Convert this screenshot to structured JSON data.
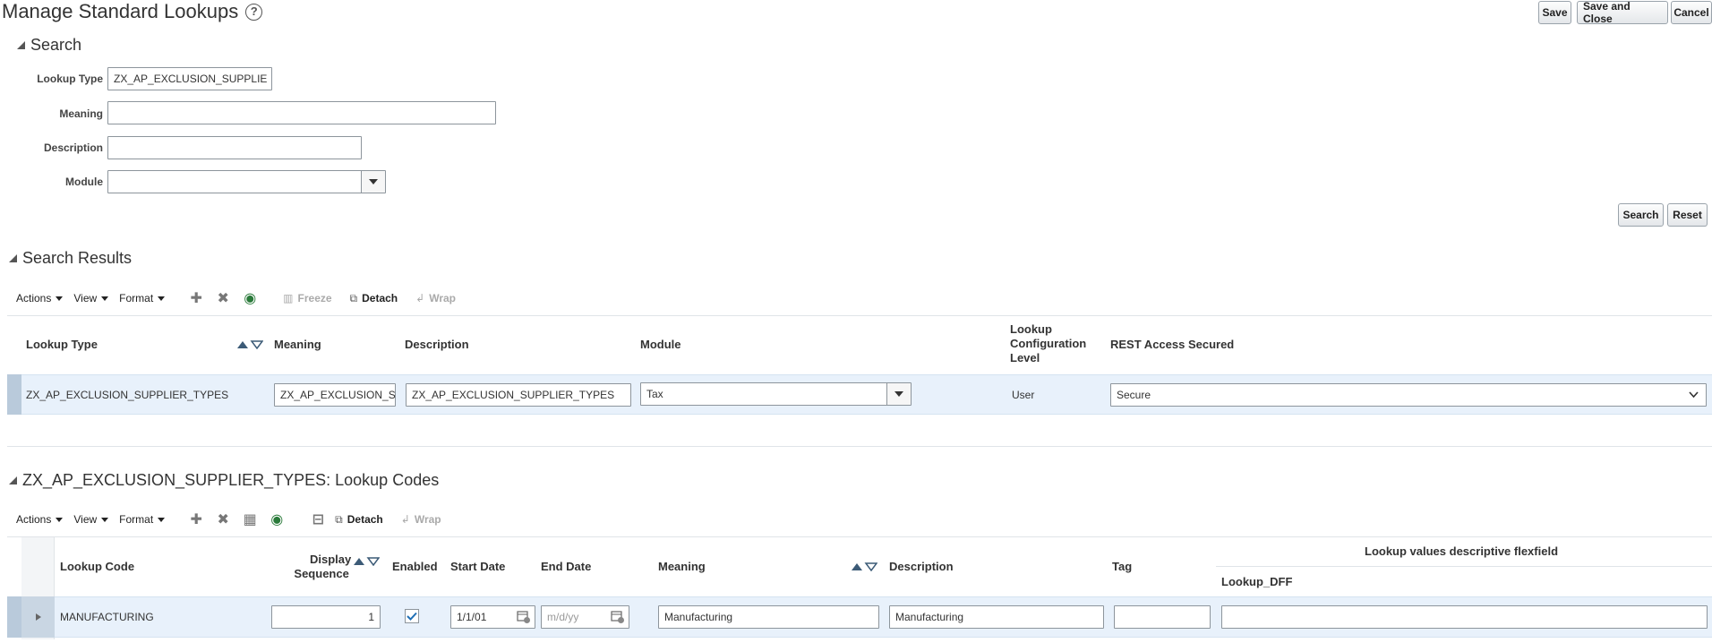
{
  "page": {
    "title": "Manage Standard Lookups",
    "help_icon": "help-icon",
    "buttons": {
      "save": "Save",
      "save_close": "Save and Close",
      "cancel": "Cancel"
    }
  },
  "search": {
    "title": "Search",
    "fields": {
      "lookup_type": {
        "label": "Lookup Type",
        "value": "ZX_AP_EXCLUSION_SUPPLIE"
      },
      "meaning": {
        "label": "Meaning",
        "value": ""
      },
      "description": {
        "label": "Description",
        "value": ""
      },
      "module": {
        "label": "Module",
        "value": ""
      }
    },
    "buttons": {
      "search": "Search",
      "reset": "Reset"
    }
  },
  "results": {
    "title": "Search Results",
    "toolbar": {
      "actions": "Actions",
      "view": "View",
      "format": "Format",
      "freeze": "Freeze",
      "detach": "Detach",
      "wrap": "Wrap"
    },
    "columns": {
      "lookup_type": "Lookup Type",
      "meaning": "Meaning",
      "description": "Description",
      "module": "Module",
      "config_level_1": "Lookup",
      "config_level_2": "Configuration",
      "config_level_3": "Level",
      "rest": "REST Access Secured"
    },
    "row": {
      "lookup_type": "ZX_AP_EXCLUSION_SUPPLIER_TYPES",
      "meaning": "ZX_AP_EXCLUSION_S",
      "description": "ZX_AP_EXCLUSION_SUPPLIER_TYPES",
      "module": "Tax",
      "config_level": "User",
      "rest": "Secure"
    }
  },
  "codes": {
    "title": "ZX_AP_EXCLUSION_SUPPLIER_TYPES: Lookup Codes",
    "toolbar": {
      "actions": "Actions",
      "view": "View",
      "format": "Format",
      "detach": "Detach",
      "wrap": "Wrap"
    },
    "columns": {
      "lookup_code": "Lookup Code",
      "display_seq_1": "Display",
      "display_seq_2": "Sequence",
      "enabled": "Enabled",
      "start_date": "Start Date",
      "end_date": "End Date",
      "meaning": "Meaning",
      "description": "Description",
      "tag": "Tag",
      "dff_group": "Lookup values descriptive flexfield",
      "dff": "Lookup_DFF"
    },
    "row": {
      "lookup_code": "MANUFACTURING",
      "display_seq": "1",
      "enabled": true,
      "start_date": "1/1/01",
      "end_date_placeholder": "m/d/yy",
      "meaning": "Manufacturing",
      "description": "Manufacturing",
      "tag": "",
      "dff": ""
    }
  }
}
